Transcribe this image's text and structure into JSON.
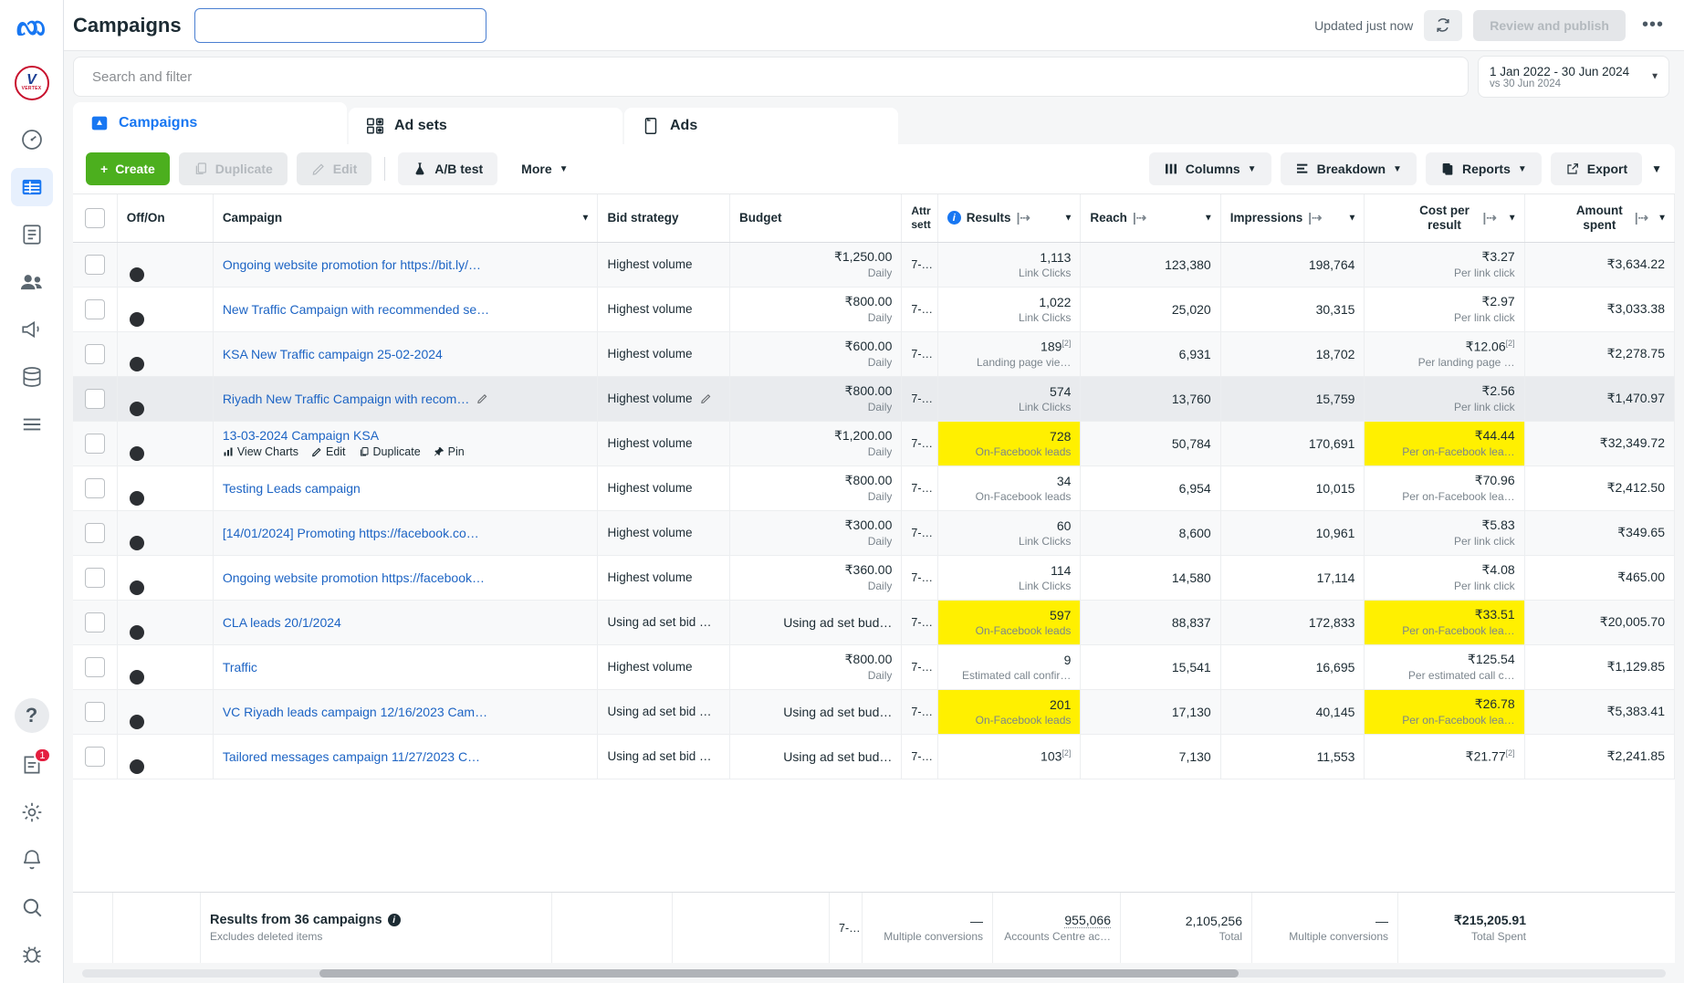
{
  "rail": {
    "items": [
      {
        "name": "meta-logo",
        "label": "Meta"
      },
      {
        "name": "vertex-account",
        "label": "VERTEX"
      },
      {
        "name": "account-overview",
        "label": "Account overview"
      },
      {
        "name": "campaigns-grid",
        "label": "Campaigns"
      },
      {
        "name": "billing",
        "label": "Billing"
      },
      {
        "name": "audiences",
        "label": "Audiences"
      },
      {
        "name": "ads-reporting",
        "label": "Ads reporting"
      },
      {
        "name": "events-manager",
        "label": "Events Manager"
      },
      {
        "name": "all-tools",
        "label": "All tools"
      },
      {
        "name": "help",
        "label": "?"
      },
      {
        "name": "updates",
        "label": "Updates",
        "badge": "1"
      },
      {
        "name": "settings",
        "label": "Settings"
      },
      {
        "name": "notifications",
        "label": "Notifications"
      },
      {
        "name": "search",
        "label": "Search"
      },
      {
        "name": "bug-report",
        "label": "Report a bug"
      }
    ]
  },
  "header": {
    "title": "Campaigns",
    "title_input_value": "",
    "title_input_placeholder": "",
    "updated_text": "Updated just now",
    "refresh_label": "Refresh",
    "review_publish_label": "Review and publish",
    "more_label": "•••"
  },
  "search": {
    "placeholder": "Search and filter",
    "value": "",
    "date_range": "1 Jan 2022 - 30 Jun 2024",
    "date_compare": "vs 30 Jun 2024"
  },
  "tabs": [
    {
      "label": "Campaigns",
      "icon": "campaign-icon",
      "active": true
    },
    {
      "label": "Ad sets",
      "icon": "adsets-icon",
      "active": false
    },
    {
      "label": "Ads",
      "icon": "ads-icon",
      "active": false
    }
  ],
  "toolbar": {
    "create_label": "Create",
    "duplicate_label": "Duplicate",
    "edit_label": "Edit",
    "abtest_label": "A/B test",
    "more_label": "More",
    "columns_label": "Columns",
    "breakdown_label": "Breakdown",
    "reports_label": "Reports",
    "export_label": "Export"
  },
  "table": {
    "columns": [
      {
        "key": "check",
        "label": ""
      },
      {
        "key": "offon",
        "label": "Off/On"
      },
      {
        "key": "campaign",
        "label": "Campaign"
      },
      {
        "key": "bid",
        "label": "Bid strategy"
      },
      {
        "key": "budget",
        "label": "Budget"
      },
      {
        "key": "attr",
        "label": "Attr",
        "label2": "sett"
      },
      {
        "key": "results",
        "label": "Results"
      },
      {
        "key": "reach",
        "label": "Reach"
      },
      {
        "key": "impressions",
        "label": "Impressions"
      },
      {
        "key": "cpr",
        "label": "Cost per",
        "label2": "result"
      },
      {
        "key": "spent",
        "label": "Amount",
        "label2": "spent"
      }
    ],
    "rows": [
      {
        "campaign": "Ongoing website promotion for https://bit.ly/…",
        "bid": "Highest volume",
        "budget": "₹1,250.00",
        "budget_sub": "Daily",
        "attr": "7-…",
        "results": "1,113",
        "results_sub": "Link Clicks",
        "results_hl": false,
        "reach": "123,380",
        "impressions": "198,764",
        "cpr": "₹3.27",
        "cpr_sub": "Per link click",
        "cpr_hl": false,
        "spent": "₹3,634.22"
      },
      {
        "campaign": "New Traffic Campaign with recommended se…",
        "bid": "Highest volume",
        "budget": "₹800.00",
        "budget_sub": "Daily",
        "attr": "7-…",
        "results": "1,022",
        "results_sub": "Link Clicks",
        "results_hl": false,
        "reach": "25,020",
        "impressions": "30,315",
        "cpr": "₹2.97",
        "cpr_sub": "Per link click",
        "cpr_hl": false,
        "spent": "₹3,033.38"
      },
      {
        "campaign": "KSA New Traffic campaign 25-02-2024",
        "bid": "Highest volume",
        "budget": "₹600.00",
        "budget_sub": "Daily",
        "attr": "7-…",
        "results": "189",
        "results_footnote": "[2]",
        "results_sub": "Landing page vie…",
        "results_hl": false,
        "reach": "6,931",
        "impressions": "18,702",
        "cpr": "₹12.06",
        "cpr_footnote": "[2]",
        "cpr_sub": "Per landing page …",
        "cpr_hl": false,
        "spent": "₹2,278.75"
      },
      {
        "campaign": "Riyadh New Traffic Campaign with recom…",
        "campaign_pencil": true,
        "bid": "Highest volume",
        "bid_pencil": true,
        "budget": "₹800.00",
        "budget_sub": "Daily",
        "attr": "7-…",
        "results": "574",
        "results_sub": "Link Clicks",
        "results_hl": false,
        "reach": "13,760",
        "impressions": "15,759",
        "cpr": "₹2.56",
        "cpr_sub": "Per link click",
        "cpr_hl": false,
        "spent": "₹1,470.97",
        "hovered": true
      },
      {
        "campaign": "13-03-2024 Campaign KSA",
        "actions": [
          "View Charts",
          "Edit",
          "Duplicate",
          "Pin"
        ],
        "bid": "Highest volume",
        "budget": "₹1,200.00",
        "budget_sub": "Daily",
        "attr": "7-…",
        "results": "728",
        "results_sub": "On-Facebook leads",
        "results_hl": true,
        "reach": "50,784",
        "impressions": "170,691",
        "cpr": "₹44.44",
        "cpr_sub": "Per on-Facebook lea…",
        "cpr_hl": true,
        "spent": "₹32,349.72"
      },
      {
        "campaign": "Testing Leads campaign",
        "bid": "Highest volume",
        "budget": "₹800.00",
        "budget_sub": "Daily",
        "attr": "7-…",
        "results": "34",
        "results_sub": "On-Facebook leads",
        "results_hl": false,
        "reach": "6,954",
        "impressions": "10,015",
        "cpr": "₹70.96",
        "cpr_sub": "Per on-Facebook lea…",
        "cpr_hl": false,
        "spent": "₹2,412.50"
      },
      {
        "campaign": "[14/01/2024] Promoting https://facebook.co…",
        "bid": "Highest volume",
        "budget": "₹300.00",
        "budget_sub": "Daily",
        "attr": "7-…",
        "results": "60",
        "results_sub": "Link Clicks",
        "results_hl": false,
        "reach": "8,600",
        "impressions": "10,961",
        "cpr": "₹5.83",
        "cpr_sub": "Per link click",
        "cpr_hl": false,
        "spent": "₹349.65"
      },
      {
        "campaign": "Ongoing website promotion https://facebook…",
        "bid": "Highest volume",
        "budget": "₹360.00",
        "budget_sub": "Daily",
        "attr": "7-…",
        "results": "114",
        "results_sub": "Link Clicks",
        "results_hl": false,
        "reach": "14,580",
        "impressions": "17,114",
        "cpr": "₹4.08",
        "cpr_sub": "Per link click",
        "cpr_hl": false,
        "spent": "₹465.00"
      },
      {
        "campaign": "CLA leads 20/1/2024",
        "bid": "Using ad set bid …",
        "budget": "Using ad set bud…",
        "budget_sub": "",
        "attr": "7-…",
        "results": "597",
        "results_sub": "On-Facebook leads",
        "results_hl": true,
        "reach": "88,837",
        "impressions": "172,833",
        "cpr": "₹33.51",
        "cpr_sub": "Per on-Facebook lea…",
        "cpr_hl": true,
        "spent": "₹20,005.70"
      },
      {
        "campaign": "Traffic",
        "bid": "Highest volume",
        "budget": "₹800.00",
        "budget_sub": "Daily",
        "attr": "7-…",
        "results": "9",
        "results_sub": "Estimated call confir…",
        "results_hl": false,
        "reach": "15,541",
        "impressions": "16,695",
        "cpr": "₹125.54",
        "cpr_sub": "Per estimated call c…",
        "cpr_hl": false,
        "spent": "₹1,129.85"
      },
      {
        "campaign": "VC Riyadh leads campaign 12/16/2023 Cam…",
        "bid": "Using ad set bid …",
        "budget": "Using ad set bud…",
        "budget_sub": "",
        "attr": "7-…",
        "results": "201",
        "results_sub": "On-Facebook leads",
        "results_hl": true,
        "reach": "17,130",
        "impressions": "40,145",
        "cpr": "₹26.78",
        "cpr_sub": "Per on-Facebook lea…",
        "cpr_hl": true,
        "spent": "₹5,383.41"
      },
      {
        "campaign": "Tailored messages campaign 11/27/2023 C…",
        "bid": "Using ad set bid …",
        "budget": "Using ad set bud…",
        "budget_sub": "",
        "attr": "7-…",
        "results": "103",
        "results_footnote": "[2]",
        "results_sub": "",
        "results_hl": false,
        "reach": "7,130",
        "impressions": "11,553",
        "cpr": "₹21.77",
        "cpr_footnote": "[2]",
        "cpr_sub": "",
        "cpr_hl": false,
        "spent": "₹2,241.85"
      }
    ],
    "summary": {
      "title": "Results from 36 campaigns",
      "note": "Excludes deleted items",
      "attr": "7-…",
      "results": "—",
      "results_sub": "Multiple conversions",
      "reach": "955,066",
      "reach_sub": "Accounts Centre ac…",
      "impressions": "2,105,256",
      "impressions_sub": "Total",
      "cpr": "—",
      "cpr_sub": "Multiple conversions",
      "spent": "₹215,205.91",
      "spent_sub": "Total Spent"
    }
  },
  "colors": {
    "accent_blue": "#1877f2",
    "link_blue": "#1d64c4",
    "create_green": "#4caf1e",
    "highlight_yellow": "#fff000",
    "badge_red": "#e41e3f"
  }
}
